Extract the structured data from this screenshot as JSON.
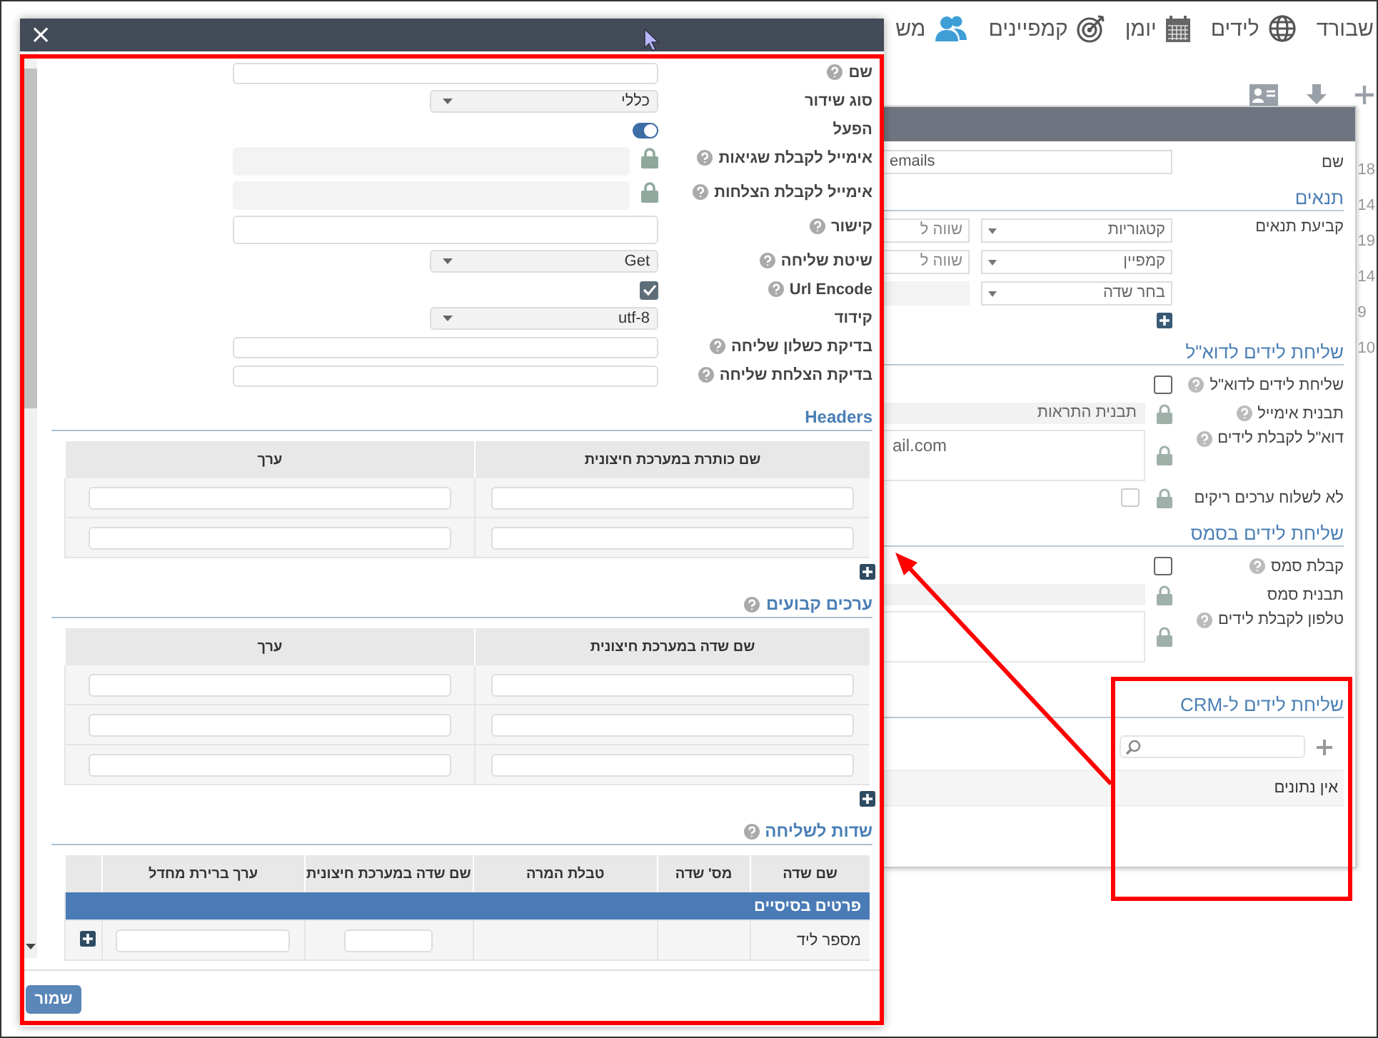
{
  "nav": {
    "items": [
      {
        "label": "שבורד"
      },
      {
        "label": "לידים"
      },
      {
        "label": "יומן"
      },
      {
        "label": "קמפיינים"
      },
      {
        "label": "מש"
      }
    ]
  },
  "row_numbers": [
    "18",
    "14",
    "19",
    "14",
    "9",
    "10"
  ],
  "panel": {
    "name": {
      "label": "שם",
      "value": "emails"
    },
    "conditions": {
      "title": "תנאים",
      "label": "קביעת תנאים",
      "rows": [
        {
          "field": "קטגוריות",
          "operator": "שווה ל"
        },
        {
          "field": "קמפיין",
          "operator": "שווה ל"
        },
        {
          "field": "בחר שדה"
        }
      ]
    },
    "email": {
      "title": "שליחת לידים לדוא\"ל",
      "rows": [
        {
          "kind": "checkbox",
          "label": "שליחת לידים לדוא\"ל",
          "help": true,
          "checked": false
        },
        {
          "kind": "locked-field",
          "label": "תבנית אימייל",
          "help": true,
          "value": "תבנית התראות"
        },
        {
          "kind": "locked-textarea",
          "label": "דוא\"ל לקבלת לידים",
          "help": true,
          "value": "ail.com"
        },
        {
          "kind": "locked-checkbox",
          "label": "לא לשלוח ערכים ריקים",
          "help": false,
          "checked": false
        }
      ]
    },
    "sms": {
      "title": "שליחת לידים בסמס",
      "rows": [
        {
          "kind": "checkbox",
          "label": "קבלת סמס",
          "help": true,
          "checked": false
        },
        {
          "kind": "locked-field",
          "label": "תבנית סמס",
          "help": false
        },
        {
          "kind": "locked-textarea",
          "label": "טלפון לקבלת לידים",
          "help": true
        }
      ]
    },
    "crm": {
      "title": "שליחת לידים ל-CRM",
      "empty": "אין נתונים"
    }
  },
  "modal": {
    "close": "×",
    "form": [
      {
        "kind": "text",
        "label": "שם",
        "help": true
      },
      {
        "kind": "select",
        "label": "סוג שידור",
        "help": false,
        "value": "כללי"
      },
      {
        "kind": "toggle",
        "label": "הפעל",
        "help": false,
        "on": true
      },
      {
        "kind": "locked",
        "label": "אימייל לקבלת שגיאות",
        "help": true
      },
      {
        "kind": "locked",
        "label": "אימייל לקבלת הצלחות",
        "help": true
      },
      {
        "kind": "link",
        "label": "קישור",
        "help": true
      },
      {
        "kind": "select",
        "label": "שיטת שליחה",
        "help": true,
        "value": "Get"
      },
      {
        "kind": "checkbox",
        "label": "Url Encode",
        "help": true,
        "checked": true
      },
      {
        "kind": "select",
        "label": "קידוד",
        "help": false,
        "value": "utf-8"
      },
      {
        "kind": "text",
        "label": "בדיקת כשלון שליחה",
        "help": true
      },
      {
        "kind": "text",
        "label": "בדיקת הצלחת שליחה",
        "help": true
      }
    ],
    "headers": {
      "title": "Headers",
      "help": false,
      "columns": [
        "שם כותרת במערכת חיצונית",
        "ערך"
      ],
      "rows": [
        {
          "kind": "inputs"
        },
        {
          "kind": "inputs"
        }
      ]
    },
    "fixed_values": {
      "title": "ערכים קבועים",
      "help": true,
      "columns": [
        "שם שדה במערכת חיצונית",
        "ערך"
      ],
      "rows": [
        {
          "kind": "inputs"
        },
        {
          "kind": "inputs"
        },
        {
          "kind": "inputs"
        }
      ]
    },
    "send_fields": {
      "title": "שדות לשליחה",
      "help": true,
      "columns": [
        "שם שדה",
        "מס' שדה",
        "טבלת המרה",
        "שם שדה במערכת חיצונית",
        "ערך ברירת מחדל"
      ],
      "groups": [
        {
          "title": "פרטים בסיסיים",
          "rows": [
            {
              "name": "מספר ליד"
            }
          ]
        }
      ]
    },
    "save": "שמור"
  }
}
